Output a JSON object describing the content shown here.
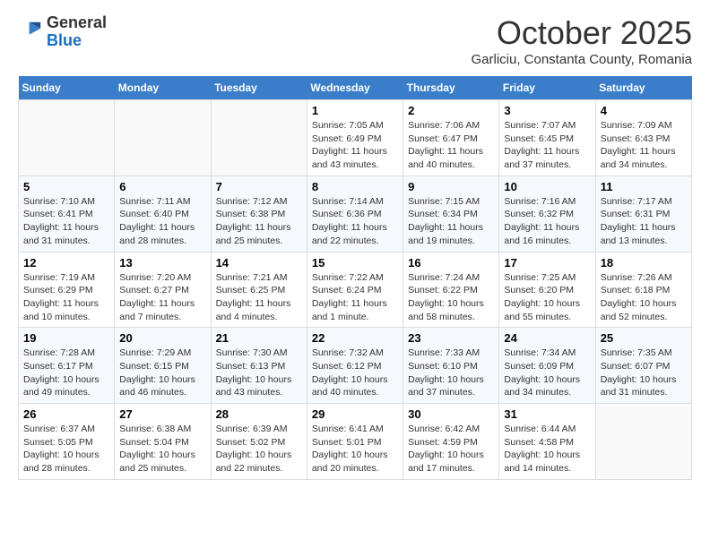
{
  "header": {
    "logo_general": "General",
    "logo_blue": "Blue",
    "month": "October 2025",
    "location": "Garliciu, Constanta County, Romania"
  },
  "weekdays": [
    "Sunday",
    "Monday",
    "Tuesday",
    "Wednesday",
    "Thursday",
    "Friday",
    "Saturday"
  ],
  "weeks": [
    [
      {
        "day": "",
        "info": ""
      },
      {
        "day": "",
        "info": ""
      },
      {
        "day": "",
        "info": ""
      },
      {
        "day": "1",
        "info": "Sunrise: 7:05 AM\nSunset: 6:49 PM\nDaylight: 11 hours\nand 43 minutes."
      },
      {
        "day": "2",
        "info": "Sunrise: 7:06 AM\nSunset: 6:47 PM\nDaylight: 11 hours\nand 40 minutes."
      },
      {
        "day": "3",
        "info": "Sunrise: 7:07 AM\nSunset: 6:45 PM\nDaylight: 11 hours\nand 37 minutes."
      },
      {
        "day": "4",
        "info": "Sunrise: 7:09 AM\nSunset: 6:43 PM\nDaylight: 11 hours\nand 34 minutes."
      }
    ],
    [
      {
        "day": "5",
        "info": "Sunrise: 7:10 AM\nSunset: 6:41 PM\nDaylight: 11 hours\nand 31 minutes."
      },
      {
        "day": "6",
        "info": "Sunrise: 7:11 AM\nSunset: 6:40 PM\nDaylight: 11 hours\nand 28 minutes."
      },
      {
        "day": "7",
        "info": "Sunrise: 7:12 AM\nSunset: 6:38 PM\nDaylight: 11 hours\nand 25 minutes."
      },
      {
        "day": "8",
        "info": "Sunrise: 7:14 AM\nSunset: 6:36 PM\nDaylight: 11 hours\nand 22 minutes."
      },
      {
        "day": "9",
        "info": "Sunrise: 7:15 AM\nSunset: 6:34 PM\nDaylight: 11 hours\nand 19 minutes."
      },
      {
        "day": "10",
        "info": "Sunrise: 7:16 AM\nSunset: 6:32 PM\nDaylight: 11 hours\nand 16 minutes."
      },
      {
        "day": "11",
        "info": "Sunrise: 7:17 AM\nSunset: 6:31 PM\nDaylight: 11 hours\nand 13 minutes."
      }
    ],
    [
      {
        "day": "12",
        "info": "Sunrise: 7:19 AM\nSunset: 6:29 PM\nDaylight: 11 hours\nand 10 minutes."
      },
      {
        "day": "13",
        "info": "Sunrise: 7:20 AM\nSunset: 6:27 PM\nDaylight: 11 hours\nand 7 minutes."
      },
      {
        "day": "14",
        "info": "Sunrise: 7:21 AM\nSunset: 6:25 PM\nDaylight: 11 hours\nand 4 minutes."
      },
      {
        "day": "15",
        "info": "Sunrise: 7:22 AM\nSunset: 6:24 PM\nDaylight: 11 hours\nand 1 minute."
      },
      {
        "day": "16",
        "info": "Sunrise: 7:24 AM\nSunset: 6:22 PM\nDaylight: 10 hours\nand 58 minutes."
      },
      {
        "day": "17",
        "info": "Sunrise: 7:25 AM\nSunset: 6:20 PM\nDaylight: 10 hours\nand 55 minutes."
      },
      {
        "day": "18",
        "info": "Sunrise: 7:26 AM\nSunset: 6:18 PM\nDaylight: 10 hours\nand 52 minutes."
      }
    ],
    [
      {
        "day": "19",
        "info": "Sunrise: 7:28 AM\nSunset: 6:17 PM\nDaylight: 10 hours\nand 49 minutes."
      },
      {
        "day": "20",
        "info": "Sunrise: 7:29 AM\nSunset: 6:15 PM\nDaylight: 10 hours\nand 46 minutes."
      },
      {
        "day": "21",
        "info": "Sunrise: 7:30 AM\nSunset: 6:13 PM\nDaylight: 10 hours\nand 43 minutes."
      },
      {
        "day": "22",
        "info": "Sunrise: 7:32 AM\nSunset: 6:12 PM\nDaylight: 10 hours\nand 40 minutes."
      },
      {
        "day": "23",
        "info": "Sunrise: 7:33 AM\nSunset: 6:10 PM\nDaylight: 10 hours\nand 37 minutes."
      },
      {
        "day": "24",
        "info": "Sunrise: 7:34 AM\nSunset: 6:09 PM\nDaylight: 10 hours\nand 34 minutes."
      },
      {
        "day": "25",
        "info": "Sunrise: 7:35 AM\nSunset: 6:07 PM\nDaylight: 10 hours\nand 31 minutes."
      }
    ],
    [
      {
        "day": "26",
        "info": "Sunrise: 6:37 AM\nSunset: 5:05 PM\nDaylight: 10 hours\nand 28 minutes."
      },
      {
        "day": "27",
        "info": "Sunrise: 6:38 AM\nSunset: 5:04 PM\nDaylight: 10 hours\nand 25 minutes."
      },
      {
        "day": "28",
        "info": "Sunrise: 6:39 AM\nSunset: 5:02 PM\nDaylight: 10 hours\nand 22 minutes."
      },
      {
        "day": "29",
        "info": "Sunrise: 6:41 AM\nSunset: 5:01 PM\nDaylight: 10 hours\nand 20 minutes."
      },
      {
        "day": "30",
        "info": "Sunrise: 6:42 AM\nSunset: 4:59 PM\nDaylight: 10 hours\nand 17 minutes."
      },
      {
        "day": "31",
        "info": "Sunrise: 6:44 AM\nSunset: 4:58 PM\nDaylight: 10 hours\nand 14 minutes."
      },
      {
        "day": "",
        "info": ""
      }
    ]
  ]
}
